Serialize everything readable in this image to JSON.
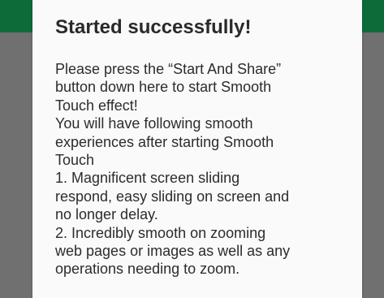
{
  "dialog": {
    "title": "Started successfully!",
    "message_lines": [
      "Please press the “Start And Share”",
      "button down here to start Smooth",
      "Touch effect!",
      "You will have following smooth",
      "experiences after starting Smooth",
      "Touch",
      "1. Magnificent screen sliding",
      "respond, easy sliding on screen and",
      "no longer delay.",
      "2. Incredibly smooth on zooming",
      "web pages or images as well as any",
      "operations needing to zoom."
    ]
  },
  "colors": {
    "app_bar": "#0d6b3a",
    "scrim": "#6f706f",
    "dialog_background": "#fafafa",
    "text": "#2c2c2c"
  }
}
